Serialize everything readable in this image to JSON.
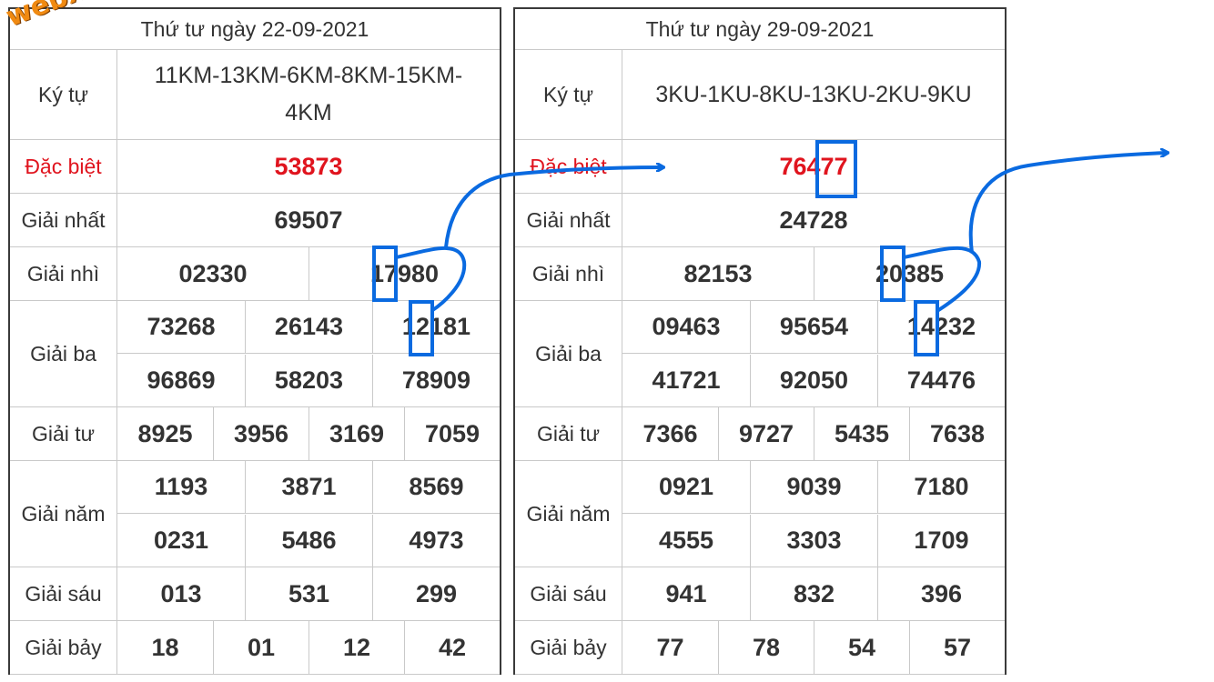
{
  "watermark": "webxoso.net",
  "accent_color": "#0a6ae0",
  "special_color": "#e0141e",
  "labels": {
    "kytu": "Ký tự",
    "dacbiet": "Đặc biệt",
    "nhat": "Giải nhất",
    "nhi": "Giải nhì",
    "ba": "Giải ba",
    "tu": "Giải tư",
    "nam": "Giải năm",
    "sau": "Giải sáu",
    "bay": "Giải bảy"
  },
  "left": {
    "date": "Thứ tư ngày 22-09-2021",
    "kytu": "11KM-13KM-6KM-8KM-15KM-4KM",
    "dacbiet": "53873",
    "nhat": "69507",
    "nhi": [
      "02330",
      "17980"
    ],
    "ba": [
      "73268",
      "26143",
      "12181",
      "96869",
      "58203",
      "78909"
    ],
    "tu": [
      "8925",
      "3956",
      "3169",
      "7059"
    ],
    "nam": [
      "1193",
      "3871",
      "8569",
      "0231",
      "5486",
      "4973"
    ],
    "sau": [
      "013",
      "531",
      "299"
    ],
    "bay": [
      "18",
      "01",
      "12",
      "42"
    ]
  },
  "right": {
    "date": "Thứ tư ngày 29-09-2021",
    "kytu": "3KU-1KU-8KU-13KU-2KU-9KU",
    "dacbiet": "76477",
    "nhat": "24728",
    "nhi": [
      "82153",
      "20385"
    ],
    "ba": [
      "09463",
      "95654",
      "14232",
      "41721",
      "92050",
      "74476"
    ],
    "tu": [
      "7366",
      "9727",
      "5435",
      "7638"
    ],
    "nam": [
      "0921",
      "9039",
      "7180",
      "4555",
      "3303",
      "1709"
    ],
    "sau": [
      "941",
      "832",
      "396"
    ],
    "bay": [
      "77",
      "78",
      "54",
      "57"
    ]
  }
}
